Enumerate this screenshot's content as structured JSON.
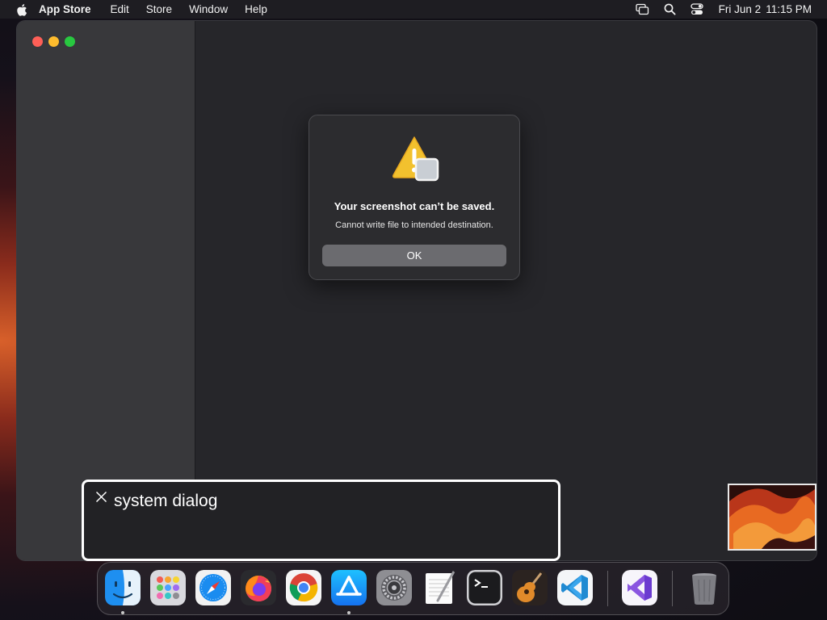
{
  "menubar": {
    "app_name": "App Store",
    "items": [
      "Edit",
      "Store",
      "Window",
      "Help"
    ],
    "date": "Fri Jun 2",
    "time": "11:15 PM"
  },
  "alert": {
    "title": "Your screenshot can’t be saved.",
    "message": "Cannot write file to intended destination.",
    "ok_label": "OK"
  },
  "caption": {
    "text": "system dialog"
  },
  "dock": {
    "apps": [
      "finder-icon",
      "launchpad-icon",
      "safari-icon",
      "firefox-icon",
      "chrome-icon",
      "app-store-icon",
      "system-settings-icon",
      "textedit-icon",
      "terminal-icon",
      "garageband-icon",
      "vscode-icon",
      "visual-studio-icon",
      "trash-icon"
    ],
    "running": [
      "finder-icon",
      "app-store-icon"
    ]
  },
  "colors": {
    "close": "#fe5f57",
    "minimize": "#febc2e",
    "zoom": "#28c840",
    "warning": "#f2c12e"
  }
}
